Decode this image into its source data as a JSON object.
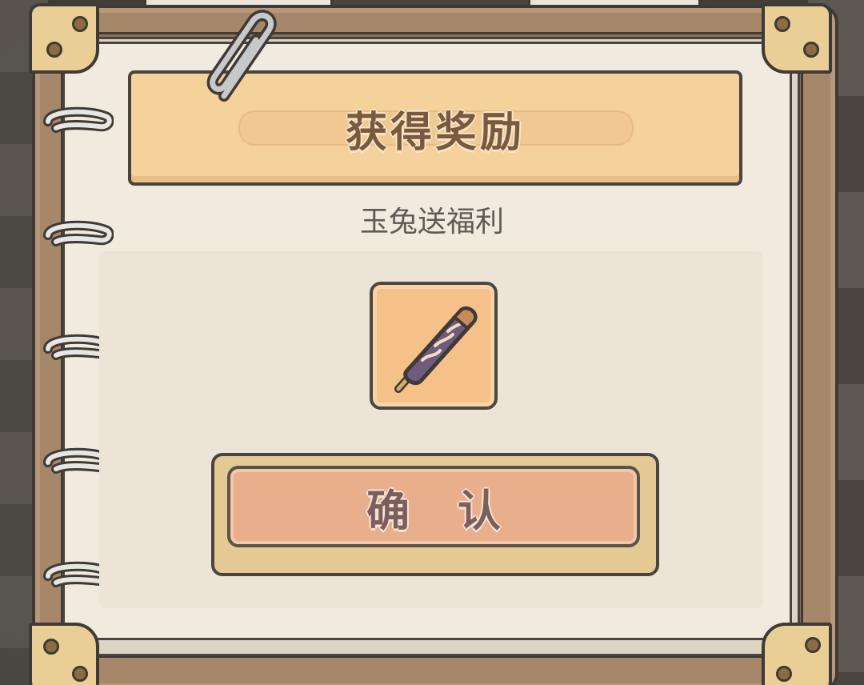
{
  "dialog": {
    "title": "获得奖励",
    "subtitle": "玉兔送福利",
    "confirm_label": "确认"
  },
  "reward": {
    "item_icon": "popsicle-icon"
  },
  "icons": {
    "clip": "paperclip-icon",
    "ring": "binder-ring-icon"
  },
  "colors": {
    "banner": "#f5d29c",
    "paper": "#f1ebdf",
    "slot": "#f6c189",
    "button": "#e9af8c"
  }
}
